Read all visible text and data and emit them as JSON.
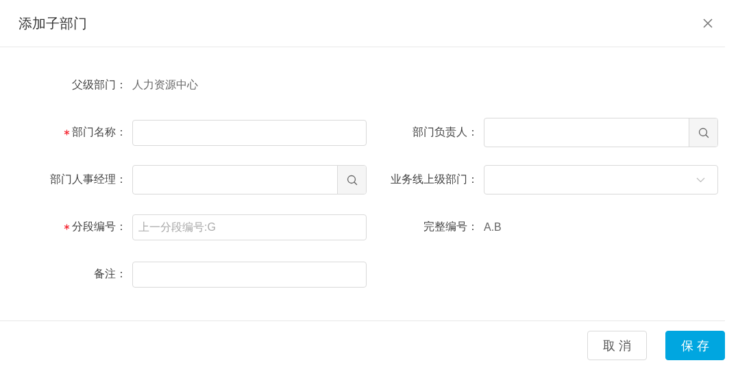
{
  "dialog": {
    "title": "添加子部门"
  },
  "rows": [
    [
      {
        "kind": "static",
        "label": "父级部门：",
        "required": false,
        "value": "人力资源中心"
      }
    ],
    [
      {
        "kind": "text",
        "label": "部门名称：",
        "required": true
      },
      {
        "kind": "search",
        "label": "部门负责人：",
        "required": false
      }
    ],
    [
      {
        "kind": "search",
        "label": "部门人事经理：",
        "required": false
      },
      {
        "kind": "select",
        "label": "业务线上级部门：",
        "required": false
      }
    ],
    [
      {
        "kind": "text",
        "label": "分段编号：",
        "required": true,
        "placeholder": "上一分段编号:G"
      },
      {
        "kind": "static",
        "label": "完整编号：",
        "required": false,
        "value": "A.B"
      }
    ],
    [
      {
        "kind": "text",
        "label": "备注：",
        "required": false
      }
    ]
  ],
  "buttons": [
    {
      "label": "取消",
      "kind": "secondary"
    },
    {
      "label": "保存",
      "kind": "primary"
    }
  ]
}
